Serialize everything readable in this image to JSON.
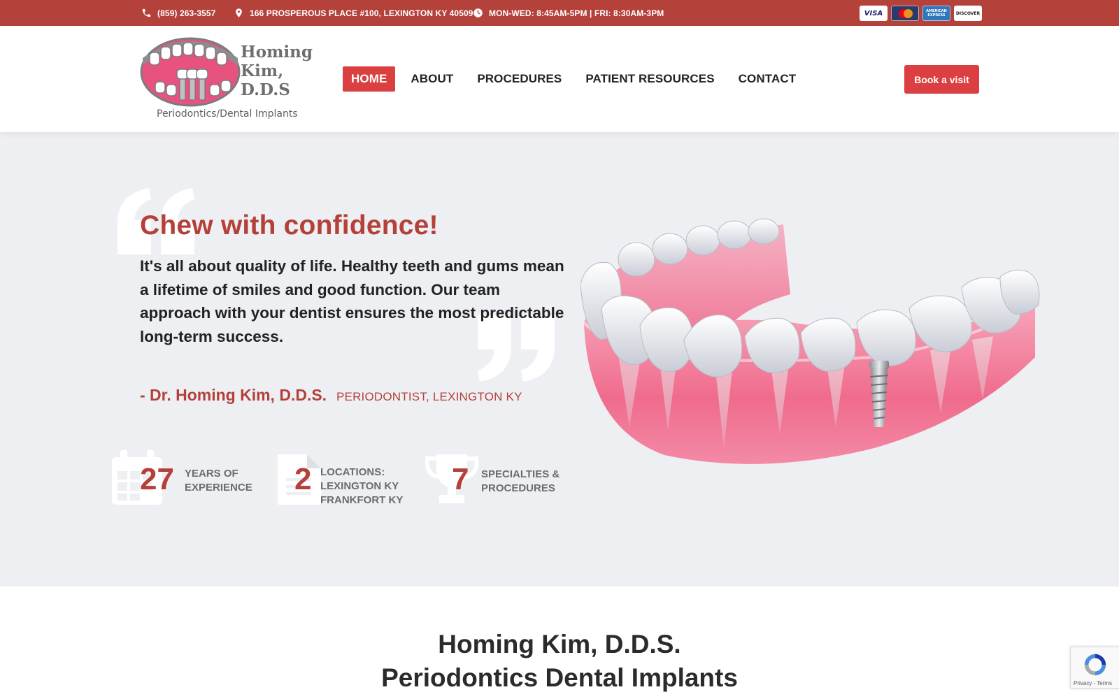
{
  "topbar": {
    "phone": "(859) 263-3557",
    "address": "166 PROSPEROUS PLACE #100, LEXINGTON KY 40509",
    "hours": "MON-WED: 8:45AM-5PM | FRI: 8:30AM-3PM",
    "cards": {
      "visa": "VISA",
      "amex": "AMERICAN EXPRESS",
      "discover": "DISCOVER"
    },
    "icons": [
      "phone-icon",
      "map-pin-icon",
      "clock-icon"
    ]
  },
  "header": {
    "logo": {
      "line1": "Homing",
      "line2": "Kim,",
      "line3": "D.D.S",
      "subtitle": "Periodontics/Dental Implants"
    },
    "nav": [
      {
        "label": "HOME",
        "active": true
      },
      {
        "label": "ABOUT",
        "active": false
      },
      {
        "label": "PROCEDURES",
        "active": false
      },
      {
        "label": "PATIENT RESOURCES",
        "active": false
      },
      {
        "label": "CONTACT",
        "active": false
      }
    ],
    "cta": "Book a visit"
  },
  "hero": {
    "title": "Chew with confidence!",
    "text": "It's all about quality of life. Healthy teeth and gums mean a lifetime of smiles and good function. Our team approach with your dentist ensures the most predictable long-term success.",
    "author": "- Dr. Homing Kim, D.D.S.",
    "role": "PERIODONTIST, LEXINGTON KY",
    "stats": [
      {
        "value": "27",
        "line1": "YEARS OF",
        "line2": "EXPERIENCE",
        "line3": "",
        "icon": "calendar-icon"
      },
      {
        "value": "2",
        "line1": "LOCATIONS:",
        "line2": "LEXINGTON KY",
        "line3": "FRANKFORT KY",
        "icon": "document-icon"
      },
      {
        "value": "7",
        "line1": "SPECIALTIES &",
        "line2": "PROCEDURES",
        "line3": "",
        "icon": "trophy-icon"
      }
    ]
  },
  "section": {
    "title_line1": "Homing Kim, D.D.S.",
    "title_line2": "Periodontics Dental Implants"
  },
  "recaptcha": {
    "text": "Privacy - Terms"
  },
  "colors": {
    "brand_red": "#b5413b",
    "button_red": "#dc3f42",
    "hero_bg": "#eeeff3",
    "stat_label": "#6b6c70"
  }
}
